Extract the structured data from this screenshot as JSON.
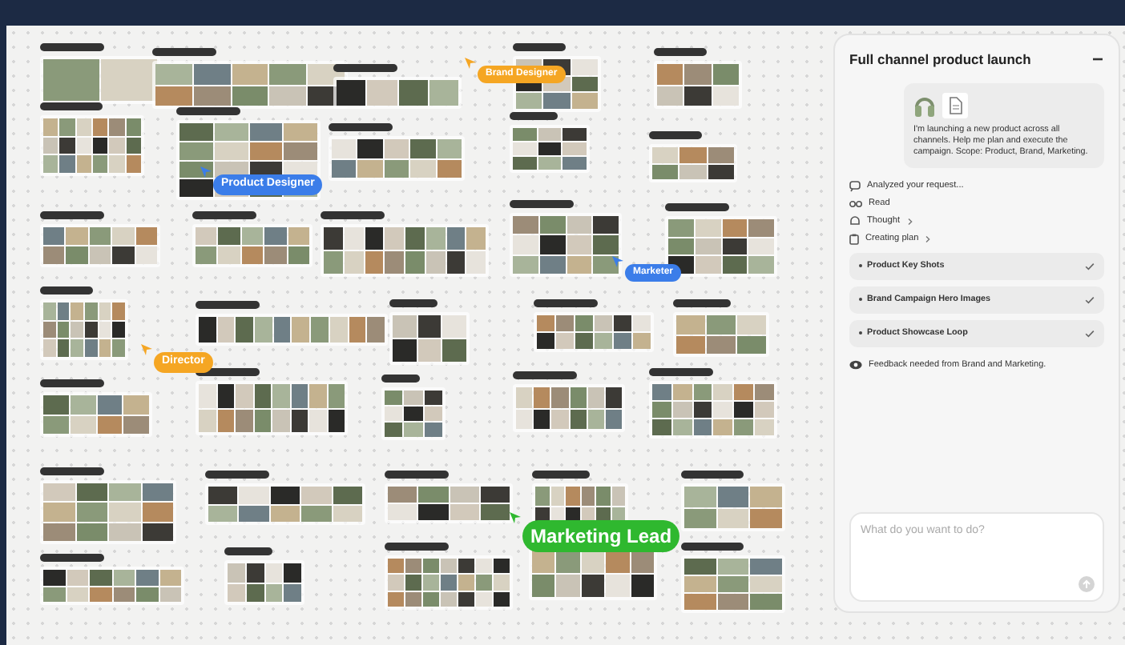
{
  "canvas": {
    "cursors": [
      {
        "label": "Product Designer",
        "color": "#3b7de9"
      },
      {
        "label": "Brand Designer",
        "color": "#f5a623"
      },
      {
        "label": "Marketer",
        "color": "#3b7de9"
      },
      {
        "label": "Director",
        "color": "#f5a623"
      },
      {
        "label": "Marketing Lead",
        "color": "#2fb82f"
      }
    ]
  },
  "panel": {
    "title": "Full channel product launch",
    "message": "I'm launching a new product across all channels. Help me plan and execute the campaign. Scope: Product, Brand, Marketing.",
    "steps": [
      {
        "kind": "analyzed",
        "text": "Analyzed your request...",
        "expandable": false
      },
      {
        "kind": "read",
        "text": "Read",
        "expandable": false
      },
      {
        "kind": "thought",
        "text": "Thought",
        "expandable": true
      },
      {
        "kind": "plan",
        "text": "Creating plan",
        "expandable": true
      }
    ],
    "plan_items": [
      {
        "title": "Product Key Shots",
        "done": true
      },
      {
        "title": "Brand Campaign Hero Images",
        "done": true
      },
      {
        "title": "Product Showcase Loop",
        "done": true
      }
    ],
    "feedback": "Feedback needed from Brand and Marketing.",
    "input": {
      "placeholder": "What do you want to do?"
    }
  }
}
